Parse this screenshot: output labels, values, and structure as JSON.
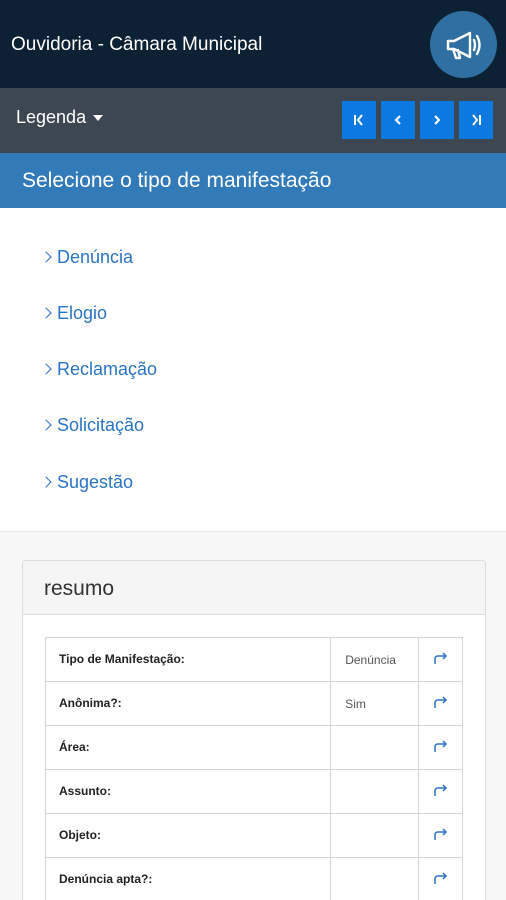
{
  "header": {
    "title": "Ouvidoria - Câmara Municipal",
    "megaphone_icon": "megaphone-icon"
  },
  "toolbar": {
    "legenda_label": "Legenda",
    "pager": [
      {
        "icon": "first-page-icon"
      },
      {
        "icon": "previous-page-icon"
      },
      {
        "icon": "next-page-icon"
      },
      {
        "icon": "last-page-icon"
      }
    ]
  },
  "section": {
    "title": "Selecione o tipo de manifestação"
  },
  "types": [
    {
      "label": "Denúncia"
    },
    {
      "label": "Elogio"
    },
    {
      "label": "Reclamação"
    },
    {
      "label": "Solicitação"
    },
    {
      "label": "Sugestão"
    }
  ],
  "summary": {
    "title": "resumo",
    "rows": [
      {
        "label": "Tipo de Manifestação:",
        "value": "Denúncia"
      },
      {
        "label": "Anônima?:",
        "value": "Sim"
      },
      {
        "label": "Área:",
        "value": ""
      },
      {
        "label": "Assunto:",
        "value": ""
      },
      {
        "label": "Objeto:",
        "value": ""
      },
      {
        "label": "Denúncia apta?:",
        "value": ""
      }
    ],
    "edit_icon": "forward-arrow-icon"
  },
  "colors": {
    "topbar": "#0c2133",
    "navbar": "#3d4752",
    "pager_button": "#0a7ae0",
    "section_header": "#327ab8",
    "link": "#2a74c4"
  }
}
